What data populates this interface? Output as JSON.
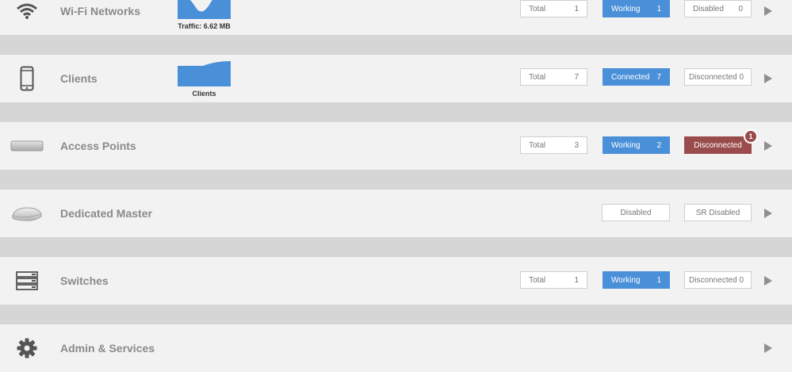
{
  "rows": {
    "wifi": {
      "title": "Wi-Fi Networks",
      "chart_label": "Traffic: 6.62 MB",
      "total_label": "Total",
      "total_value": "1",
      "working_label": "Working",
      "working_value": "1",
      "disabled_label": "Disabled",
      "disabled_value": "0"
    },
    "clients": {
      "title": "Clients",
      "chart_label": "Clients",
      "total_label": "Total",
      "total_value": "7",
      "connected_label": "Connected",
      "connected_value": "7",
      "disconnected_label": "Disconnected",
      "disconnected_value": "0"
    },
    "access_points": {
      "title": "Access Points",
      "total_label": "Total",
      "total_value": "3",
      "working_label": "Working",
      "working_value": "2",
      "disconnected_label": "Disconnected",
      "alert_count": "1"
    },
    "dedicated_master": {
      "title": "Dedicated Master",
      "disabled_label": "Disabled",
      "sr_disabled_label": "SR Disabled"
    },
    "switches": {
      "title": "Switches",
      "total_label": "Total",
      "total_value": "1",
      "working_label": "Working",
      "working_value": "1",
      "disconnected_label": "Disconnected",
      "disconnected_value": "0"
    },
    "admin": {
      "title": "Admin & Services"
    }
  },
  "colors": {
    "accent_blue": "#4a90d9",
    "alert_red": "#9a4c4c",
    "row_bg": "#f2f2f2",
    "gap_bg": "#d6d6d6"
  },
  "icons": [
    "wifi-icon",
    "smartphone-icon",
    "access-point-device-icon",
    "dedicated-master-device-icon",
    "switch-stack-icon",
    "gear-icon",
    "chevron-right-icon"
  ]
}
